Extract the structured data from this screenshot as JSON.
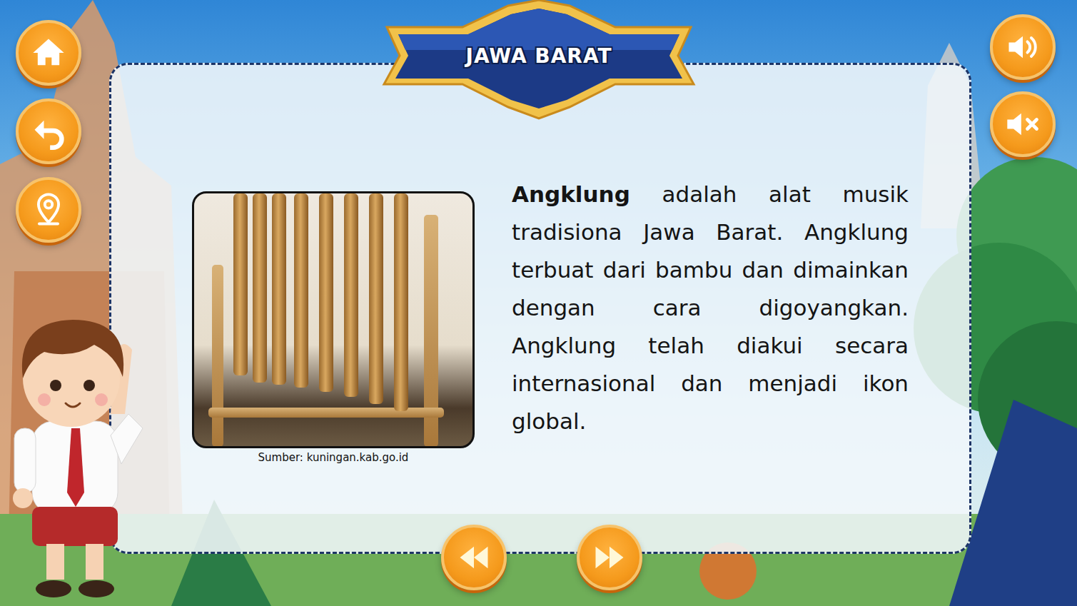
{
  "title": "JAWA BARAT",
  "photo": {
    "caption": "Sumber: kuningan.kab.go.id"
  },
  "description": {
    "term": "Angklung",
    "text": " adalah alat musik tradisiona Jawa Barat. Angklung terbuat dari bambu dan dimainkan dengan cara digoyangkan. Angklung telah diakui secara internasional dan menjadi ikon global."
  }
}
